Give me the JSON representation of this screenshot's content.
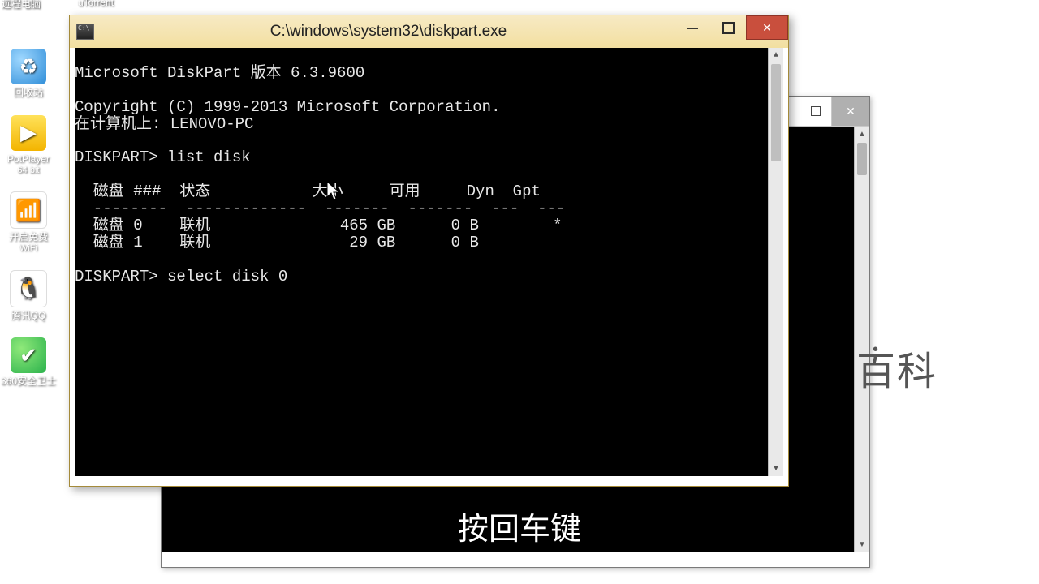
{
  "desktop": {
    "top_partial1": "远程电脑",
    "top_partial2": "uTorrent",
    "recycle": "回收站",
    "potplayer_line1": "PotPlayer",
    "potplayer_line2": "64 bit",
    "wifi_line1": "开启免费",
    "wifi_line2": "WiFi",
    "qq": "腾讯QQ",
    "safe": "360安全卫士"
  },
  "window": {
    "title": "C:\\windows\\system32\\diskpart.exe",
    "minimize": "—",
    "close": "✕"
  },
  "terminal": {
    "line1": "Microsoft DiskPart 版本 6.3.9600",
    "blank": "",
    "line2": "Copyright (C) 1999-2013 Microsoft Corporation.",
    "line3": "在计算机上: LENOVO-PC",
    "prompt1": "DISKPART> list disk",
    "header": "  磁盘 ###  状态           大小     可用     Dyn  Gpt",
    "rule": "  --------  -------------  -------  -------  ---  ---",
    "row0": "  磁盘 0    联机              465 GB      0 B        *",
    "row1": "  磁盘 1    联机               29 GB      0 B",
    "prompt2": "DISKPART> select disk 0"
  },
  "bgwin": {
    "close": "✕"
  },
  "side_logo": "百科",
  "caption": "按回车键",
  "chart_data": {
    "type": "table",
    "title": "DISKPART > list disk",
    "columns": [
      "磁盘 ###",
      "状态",
      "大小",
      "可用",
      "Dyn",
      "Gpt"
    ],
    "rows": [
      {
        "disk": "磁盘 0",
        "status": "联机",
        "size": "465 GB",
        "free": "0 B",
        "dyn": "",
        "gpt": "*"
      },
      {
        "disk": "磁盘 1",
        "status": "联机",
        "size": "29 GB",
        "free": "0 B",
        "dyn": "",
        "gpt": ""
      }
    ],
    "next_command": "select disk 0"
  }
}
